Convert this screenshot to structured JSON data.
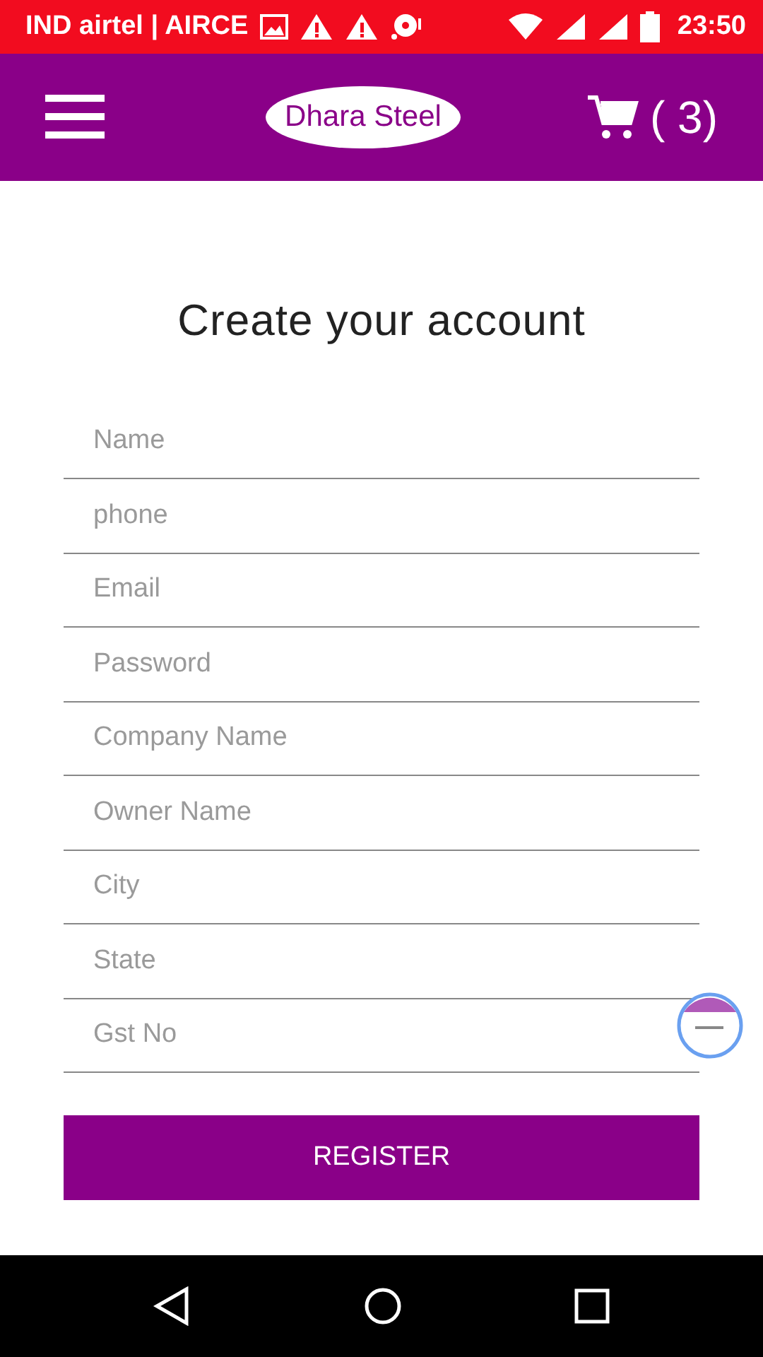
{
  "status_bar": {
    "carrier": "IND airtel | AIRCE",
    "time": "23:50"
  },
  "header": {
    "logo": "Dhara Steel",
    "cart_count": "( 3)"
  },
  "title": "Create your account",
  "fields": [
    {
      "placeholder": "Name"
    },
    {
      "placeholder": "phone"
    },
    {
      "placeholder": "Email"
    },
    {
      "placeholder": "Password"
    },
    {
      "placeholder": "Company Name"
    },
    {
      "placeholder": "Owner Name"
    },
    {
      "placeholder": "City"
    },
    {
      "placeholder": "State"
    },
    {
      "placeholder": "Gst No"
    }
  ],
  "register_button": "REGISTER"
}
